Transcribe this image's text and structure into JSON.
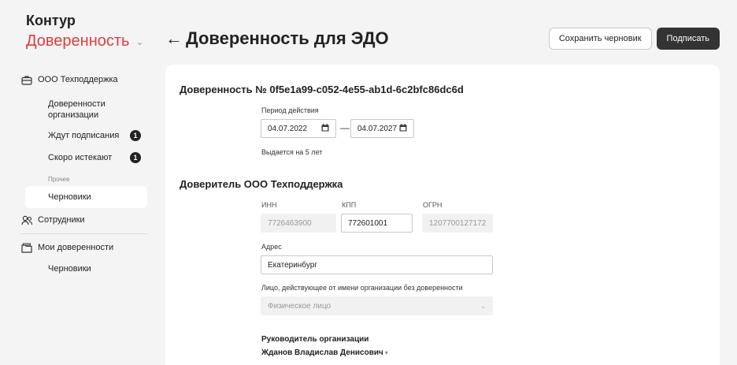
{
  "brand": {
    "name": "Контур",
    "product": "Доверенность"
  },
  "sidebar": {
    "org": "ООО Техподдержка",
    "items": [
      {
        "label": "Доверенности организации"
      },
      {
        "label": "Ждут подписания",
        "badge": "1"
      },
      {
        "label": "Скоро истекают",
        "badge": "1"
      }
    ],
    "other_caption": "Прочее",
    "drafts": "Черновики",
    "employees": "Сотрудники",
    "my_poa": "Мои доверенности",
    "my_drafts": "Черновики"
  },
  "header": {
    "back": "←",
    "title": "Доверенность для ЭДО",
    "save_draft": "Сохранить черновик",
    "sign": "Подписать"
  },
  "form": {
    "poa_title": "Доверенность № 0f5e1a99-c052-4e55-ab1d-6c2bfc86dc6d",
    "period_label": "Период действия",
    "date_from": "04.07.2022",
    "date_to": "04.07.2027",
    "period_dash": "—",
    "period_hint": "Выдается на 5 лет",
    "principal_title": "Доверитель ООО Техподдержка",
    "inn_label": "ИНН",
    "inn_value": "7726463900",
    "kpp_label": "КПП",
    "kpp_value": "772601001",
    "ogrn_label": "ОГРН",
    "ogrn_value": "1207700127172",
    "address_label": "Адрес",
    "address_value": "Екатеринбург",
    "acting_label": "Лицо, действующее от имени организации без доверенности",
    "acting_value": "Физическое лицо",
    "head_label": "Руководитель организации",
    "head_value": "Жданов Владислав Денисович"
  }
}
